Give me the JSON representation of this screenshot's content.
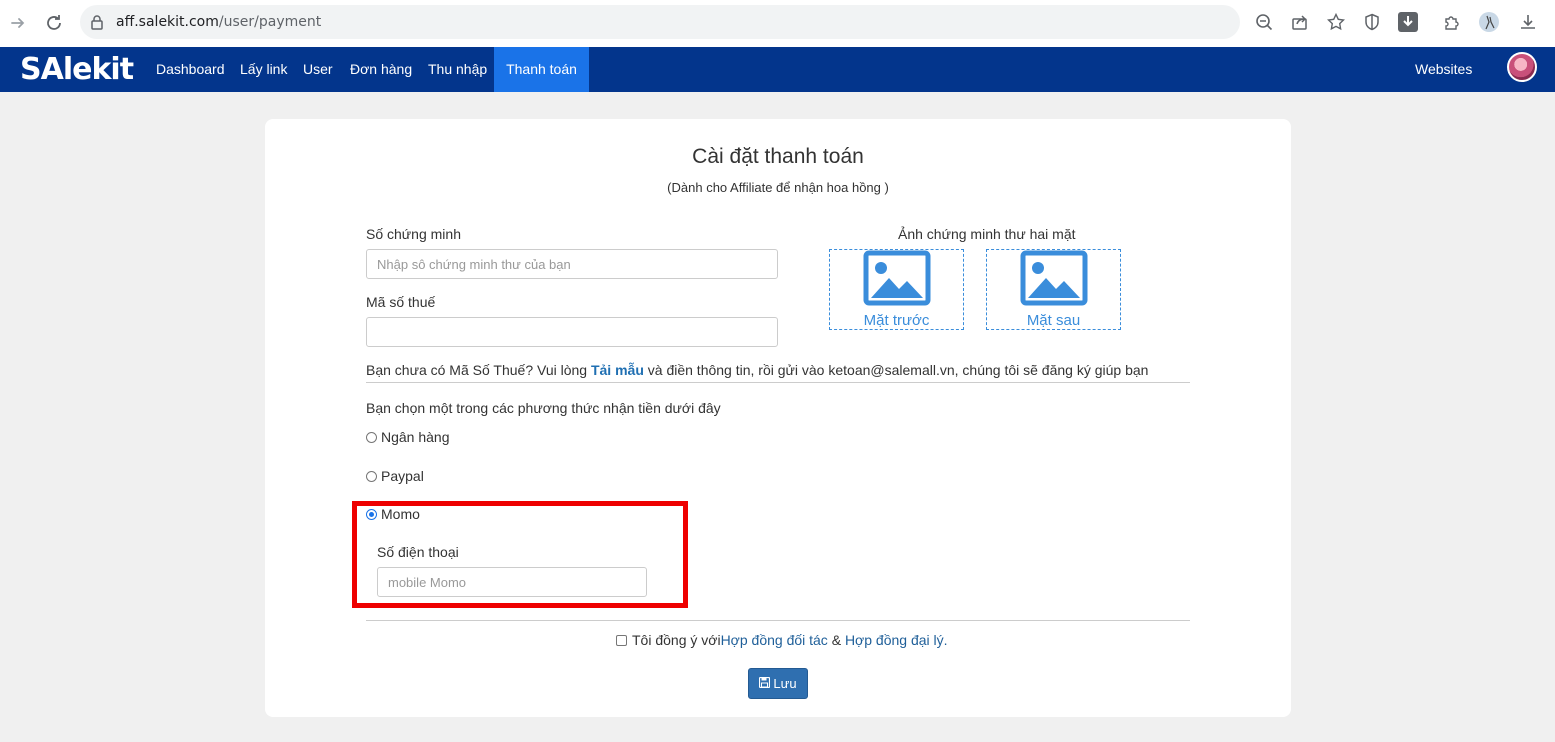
{
  "browser": {
    "url_host": "aff.salekit.com",
    "url_path": "/user/payment"
  },
  "navbar": {
    "brand": "SAlekit",
    "items": [
      {
        "label": "Dashboard"
      },
      {
        "label": "Lấy link"
      },
      {
        "label": "User"
      },
      {
        "label": "Đơn hàng"
      },
      {
        "label": "Thu nhập"
      },
      {
        "label": "Thanh toán",
        "active": true
      }
    ],
    "right_link": "Websites"
  },
  "form": {
    "title": "Cài đặt thanh toán",
    "subtitle": "(Dành cho Affiliate để nhận hoa hồng )",
    "id_number_label": "Số chứng minh",
    "id_number_placeholder": "Nhập sô chứng minh thư của bạn",
    "id_number_value": "",
    "tax_label": "Mã số thuế",
    "tax_value": "",
    "id_photo_label": "Ảnh chứng minh thư hai mặt",
    "front_caption": "Mặt trước",
    "back_caption": "Mặt sau",
    "hint_before": "Bạn chưa có Mã Số Thuế? Vui lòng ",
    "hint_link": "Tải mẫu",
    "hint_after": " và điền thông tin, rồi gửi vào ketoan@salemall.vn, chúng tôi sẽ đăng ký giúp bạn",
    "method_label": "Bạn chọn một trong các phương thức nhận tiền dưới đây",
    "methods": [
      {
        "label": "Ngân hàng",
        "checked": false
      },
      {
        "label": "Paypal",
        "checked": false
      },
      {
        "label": "Momo",
        "checked": true
      }
    ],
    "phone_label": "Số điện thoại",
    "phone_placeholder": "mobile Momo",
    "agree_text": "Tôi đồng ý với ",
    "agree_link1": "Hợp đồng đối tác",
    "agree_and": " & ",
    "agree_link2": "Hợp đồng đại lý",
    "agree_end": ".",
    "save_label": "Lưu"
  },
  "colors": {
    "navbar": "#03358c",
    "nav_active": "#1a73e8",
    "highlight": "#ee0000",
    "accent": "#3a8ddb"
  }
}
